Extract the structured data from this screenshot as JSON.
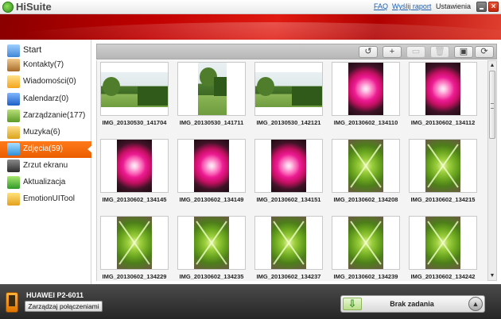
{
  "app": {
    "title": "HiSuite",
    "links": {
      "faq": "FAQ",
      "report": "Wyślij raport",
      "settings": "Ustawienia"
    }
  },
  "sidebar": {
    "items": [
      {
        "label": "Start",
        "icon": "home-icon"
      },
      {
        "label": "Kontakty(7)",
        "icon": "contacts-icon"
      },
      {
        "label": "Wiadomości(0)",
        "icon": "messages-icon"
      },
      {
        "label": "Kalendarz(0)",
        "icon": "calendar-icon"
      },
      {
        "label": "Zarządzanie(177)",
        "icon": "apps-icon"
      },
      {
        "label": "Muzyka(6)",
        "icon": "music-icon"
      },
      {
        "label": "Zdjęcia(59)",
        "icon": "photos-icon",
        "active": true
      },
      {
        "label": "Zrzut ekranu",
        "icon": "camera-icon"
      },
      {
        "label": "Aktualizacja",
        "icon": "update-icon"
      },
      {
        "label": "EmotionUITool",
        "icon": "emotion-ui-icon"
      }
    ]
  },
  "toolbar": {
    "buttons": [
      {
        "name": "undo",
        "glyph": "↺",
        "enabled": true
      },
      {
        "name": "add",
        "glyph": "+",
        "enabled": true
      },
      {
        "name": "export",
        "glyph": "▭",
        "enabled": false
      },
      {
        "name": "delete",
        "glyph": "🗑",
        "enabled": false
      },
      {
        "name": "wallpaper",
        "glyph": "▣",
        "enabled": true
      },
      {
        "name": "refresh",
        "glyph": "⟳",
        "enabled": true
      }
    ]
  },
  "photos": [
    {
      "name": "IMG_20130530_141704",
      "kind": "garden"
    },
    {
      "name": "IMG_20130530_141711",
      "kind": "garden"
    },
    {
      "name": "IMG_20130530_142121",
      "kind": "garden"
    },
    {
      "name": "IMG_20130602_134110",
      "kind": "flower"
    },
    {
      "name": "IMG_20130602_134112",
      "kind": "flower"
    },
    {
      "name": "IMG_20130602_134145",
      "kind": "flower"
    },
    {
      "name": "IMG_20130602_134149",
      "kind": "flower"
    },
    {
      "name": "IMG_20130602_134151",
      "kind": "flower"
    },
    {
      "name": "IMG_20130602_134208",
      "kind": "leaf"
    },
    {
      "name": "IMG_20130602_134215",
      "kind": "leaf"
    },
    {
      "name": "IMG_20130602_134229",
      "kind": "leaf"
    },
    {
      "name": "IMG_20130602_134235",
      "kind": "leaf"
    },
    {
      "name": "IMG_20130602_134237",
      "kind": "leaf"
    },
    {
      "name": "IMG_20130602_134239",
      "kind": "leaf"
    },
    {
      "name": "IMG_20130602_134242",
      "kind": "leaf"
    }
  ],
  "footer": {
    "device": "HUAWEI P2-6011",
    "manage_label": "Zarządzaj połączeniami",
    "task_label": "Brak zadania"
  },
  "colors": {
    "accent": "#ea5d00",
    "banner": "#c00000"
  }
}
